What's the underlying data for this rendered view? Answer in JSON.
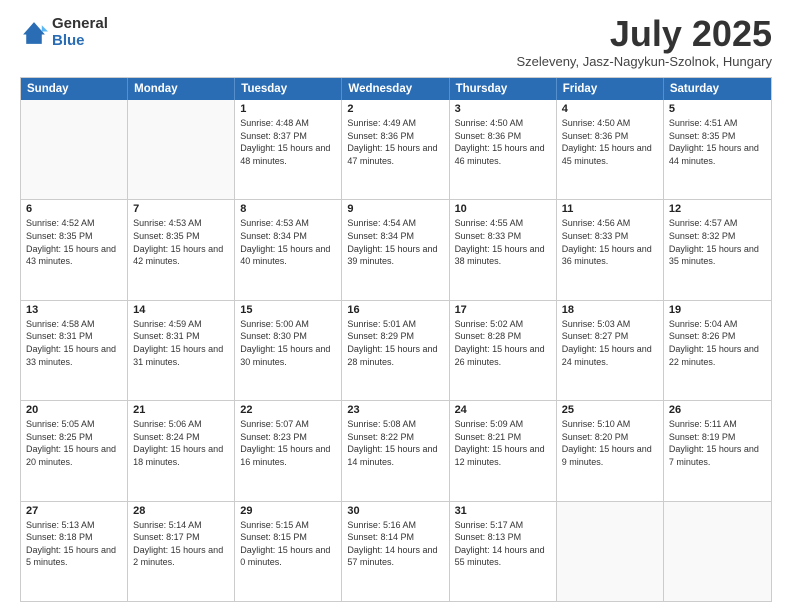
{
  "logo": {
    "general": "General",
    "blue": "Blue"
  },
  "title": "July 2025",
  "subtitle": "Szeleveny, Jasz-Nagykun-Szolnok, Hungary",
  "header_days": [
    "Sunday",
    "Monday",
    "Tuesday",
    "Wednesday",
    "Thursday",
    "Friday",
    "Saturday"
  ],
  "weeks": [
    [
      {
        "day": "",
        "content": ""
      },
      {
        "day": "",
        "content": ""
      },
      {
        "day": "1",
        "content": "Sunrise: 4:48 AM\nSunset: 8:37 PM\nDaylight: 15 hours and 48 minutes."
      },
      {
        "day": "2",
        "content": "Sunrise: 4:49 AM\nSunset: 8:36 PM\nDaylight: 15 hours and 47 minutes."
      },
      {
        "day": "3",
        "content": "Sunrise: 4:50 AM\nSunset: 8:36 PM\nDaylight: 15 hours and 46 minutes."
      },
      {
        "day": "4",
        "content": "Sunrise: 4:50 AM\nSunset: 8:36 PM\nDaylight: 15 hours and 45 minutes."
      },
      {
        "day": "5",
        "content": "Sunrise: 4:51 AM\nSunset: 8:35 PM\nDaylight: 15 hours and 44 minutes."
      }
    ],
    [
      {
        "day": "6",
        "content": "Sunrise: 4:52 AM\nSunset: 8:35 PM\nDaylight: 15 hours and 43 minutes."
      },
      {
        "day": "7",
        "content": "Sunrise: 4:53 AM\nSunset: 8:35 PM\nDaylight: 15 hours and 42 minutes."
      },
      {
        "day": "8",
        "content": "Sunrise: 4:53 AM\nSunset: 8:34 PM\nDaylight: 15 hours and 40 minutes."
      },
      {
        "day": "9",
        "content": "Sunrise: 4:54 AM\nSunset: 8:34 PM\nDaylight: 15 hours and 39 minutes."
      },
      {
        "day": "10",
        "content": "Sunrise: 4:55 AM\nSunset: 8:33 PM\nDaylight: 15 hours and 38 minutes."
      },
      {
        "day": "11",
        "content": "Sunrise: 4:56 AM\nSunset: 8:33 PM\nDaylight: 15 hours and 36 minutes."
      },
      {
        "day": "12",
        "content": "Sunrise: 4:57 AM\nSunset: 8:32 PM\nDaylight: 15 hours and 35 minutes."
      }
    ],
    [
      {
        "day": "13",
        "content": "Sunrise: 4:58 AM\nSunset: 8:31 PM\nDaylight: 15 hours and 33 minutes."
      },
      {
        "day": "14",
        "content": "Sunrise: 4:59 AM\nSunset: 8:31 PM\nDaylight: 15 hours and 31 minutes."
      },
      {
        "day": "15",
        "content": "Sunrise: 5:00 AM\nSunset: 8:30 PM\nDaylight: 15 hours and 30 minutes."
      },
      {
        "day": "16",
        "content": "Sunrise: 5:01 AM\nSunset: 8:29 PM\nDaylight: 15 hours and 28 minutes."
      },
      {
        "day": "17",
        "content": "Sunrise: 5:02 AM\nSunset: 8:28 PM\nDaylight: 15 hours and 26 minutes."
      },
      {
        "day": "18",
        "content": "Sunrise: 5:03 AM\nSunset: 8:27 PM\nDaylight: 15 hours and 24 minutes."
      },
      {
        "day": "19",
        "content": "Sunrise: 5:04 AM\nSunset: 8:26 PM\nDaylight: 15 hours and 22 minutes."
      }
    ],
    [
      {
        "day": "20",
        "content": "Sunrise: 5:05 AM\nSunset: 8:25 PM\nDaylight: 15 hours and 20 minutes."
      },
      {
        "day": "21",
        "content": "Sunrise: 5:06 AM\nSunset: 8:24 PM\nDaylight: 15 hours and 18 minutes."
      },
      {
        "day": "22",
        "content": "Sunrise: 5:07 AM\nSunset: 8:23 PM\nDaylight: 15 hours and 16 minutes."
      },
      {
        "day": "23",
        "content": "Sunrise: 5:08 AM\nSunset: 8:22 PM\nDaylight: 15 hours and 14 minutes."
      },
      {
        "day": "24",
        "content": "Sunrise: 5:09 AM\nSunset: 8:21 PM\nDaylight: 15 hours and 12 minutes."
      },
      {
        "day": "25",
        "content": "Sunrise: 5:10 AM\nSunset: 8:20 PM\nDaylight: 15 hours and 9 minutes."
      },
      {
        "day": "26",
        "content": "Sunrise: 5:11 AM\nSunset: 8:19 PM\nDaylight: 15 hours and 7 minutes."
      }
    ],
    [
      {
        "day": "27",
        "content": "Sunrise: 5:13 AM\nSunset: 8:18 PM\nDaylight: 15 hours and 5 minutes."
      },
      {
        "day": "28",
        "content": "Sunrise: 5:14 AM\nSunset: 8:17 PM\nDaylight: 15 hours and 2 minutes."
      },
      {
        "day": "29",
        "content": "Sunrise: 5:15 AM\nSunset: 8:15 PM\nDaylight: 15 hours and 0 minutes."
      },
      {
        "day": "30",
        "content": "Sunrise: 5:16 AM\nSunset: 8:14 PM\nDaylight: 14 hours and 57 minutes."
      },
      {
        "day": "31",
        "content": "Sunrise: 5:17 AM\nSunset: 8:13 PM\nDaylight: 14 hours and 55 minutes."
      },
      {
        "day": "",
        "content": ""
      },
      {
        "day": "",
        "content": ""
      }
    ]
  ]
}
